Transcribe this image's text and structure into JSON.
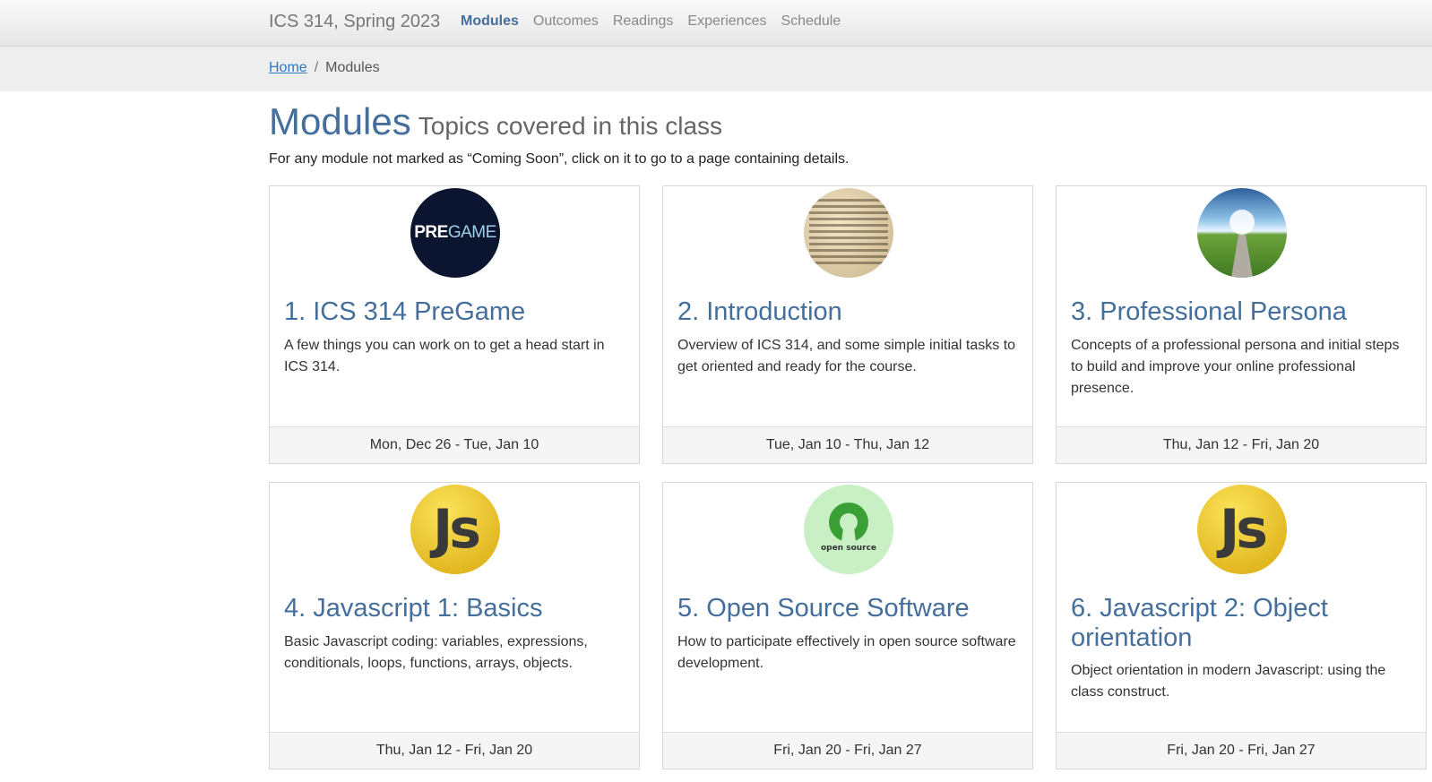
{
  "navbar": {
    "brand": "ICS 314, Spring 2023",
    "links": [
      "Modules",
      "Outcomes",
      "Readings",
      "Experiences",
      "Schedule"
    ],
    "active": "Modules"
  },
  "breadcrumb": {
    "home": "Home",
    "separator": "/",
    "current": "Modules"
  },
  "header": {
    "title": "Modules",
    "subtitle": "Topics covered in this class",
    "intro": "For any module not marked as “Coming Soon”, click on it to go to a page containing details."
  },
  "modules": [
    {
      "title": "1. ICS 314 PreGame",
      "description": "A few things you can work on to get a head start in ICS 314.",
      "dates": "Mon, Dec 26 - Tue, Jan 10",
      "icon": "pregame-logo",
      "logo_text": [
        "PRE",
        "GAME"
      ]
    },
    {
      "title": "2. Introduction",
      "description": "Overview of ICS 314, and some simple initial tasks to get oriented and ready for the course.",
      "dates": "Tue, Jan 10 - Thu, Jan 12",
      "icon": "dictionary-page-image"
    },
    {
      "title": "3. Professional Persona",
      "description": "Concepts of a professional persona and initial steps to build and improve your online professional presence.",
      "dates": "Thu, Jan 12 - Fri, Jan 20",
      "icon": "road-landscape-image"
    },
    {
      "title": "4. Javascript 1: Basics",
      "description": "Basic Javascript coding: variables, expressions, conditionals, loops, functions, arrays, objects.",
      "dates": "Thu, Jan 12 - Fri, Jan 20",
      "icon": "javascript-logo",
      "logo_text": "Js"
    },
    {
      "title": "5. Open Source Software",
      "description": "How to participate effectively in open source software development.",
      "dates": "Fri, Jan 20 - Fri, Jan 27",
      "icon": "open-source-logo",
      "logo_text": "open source"
    },
    {
      "title": "6. Javascript 2: Object orientation",
      "description": "Object orientation in modern Javascript: using the class construct.",
      "dates": "Fri, Jan 20 - Fri, Jan 27",
      "icon": "javascript-logo",
      "logo_text": "Js"
    }
  ],
  "colors": {
    "link": "#446e9b",
    "navbar_bg": "#ececec",
    "footer_bg": "#f5f5f5"
  }
}
